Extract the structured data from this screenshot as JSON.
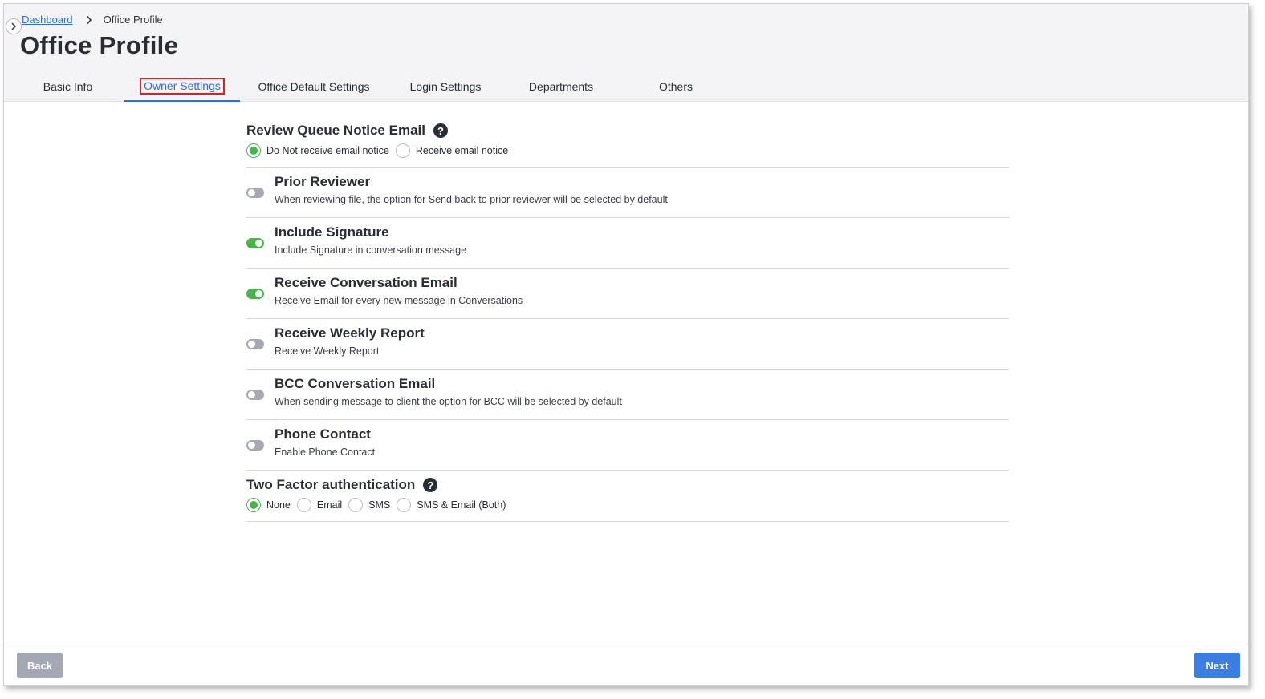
{
  "breadcrumb": {
    "home": "Dashboard",
    "current": "Office Profile"
  },
  "page": {
    "title": "Office Profile"
  },
  "tabs": [
    {
      "label": "Basic Info"
    },
    {
      "label": "Owner Settings"
    },
    {
      "label": "Office Default Settings"
    },
    {
      "label": "Login Settings"
    },
    {
      "label": "Departments"
    },
    {
      "label": "Others"
    }
  ],
  "active_tab": "Owner Settings",
  "review_queue": {
    "title": "Review Queue Notice Email",
    "options": [
      "Do Not receive email notice",
      "Receive email notice"
    ],
    "selected": "Do Not receive email notice"
  },
  "toggles": [
    {
      "title": "Prior Reviewer",
      "desc": "When reviewing file, the option for Send back to prior reviewer will be selected by default",
      "on": false
    },
    {
      "title": "Include Signature",
      "desc": "Include Signature in conversation message",
      "on": true
    },
    {
      "title": "Receive Conversation Email",
      "desc": "Receive Email for every new message in Conversations",
      "on": true
    },
    {
      "title": "Receive Weekly Report",
      "desc": "Receive Weekly Report",
      "on": false
    },
    {
      "title": "BCC Conversation Email",
      "desc": "When sending message to client the option for BCC will be selected by default",
      "on": false
    },
    {
      "title": "Phone Contact",
      "desc": "Enable Phone Contact",
      "on": false
    }
  ],
  "two_factor": {
    "title": "Two Factor authentication",
    "options": [
      "None",
      "Email",
      "SMS",
      "SMS & Email (Both)"
    ],
    "selected": "None"
  },
  "footer": {
    "back_label": "Back",
    "next_label": "Next"
  },
  "colors": {
    "accent": "#2f6fd6",
    "toggle_on": "#48b54a",
    "toggle_off": "#a7a9b0",
    "highlight_box": "#e11d1d",
    "next_button": "#3b7de0",
    "back_button": "#a3a8b4"
  },
  "icons": {
    "collapse": "chevron-right-icon",
    "breadcrumb_sep": "chevron-right-icon",
    "help": "question-circle-icon"
  }
}
